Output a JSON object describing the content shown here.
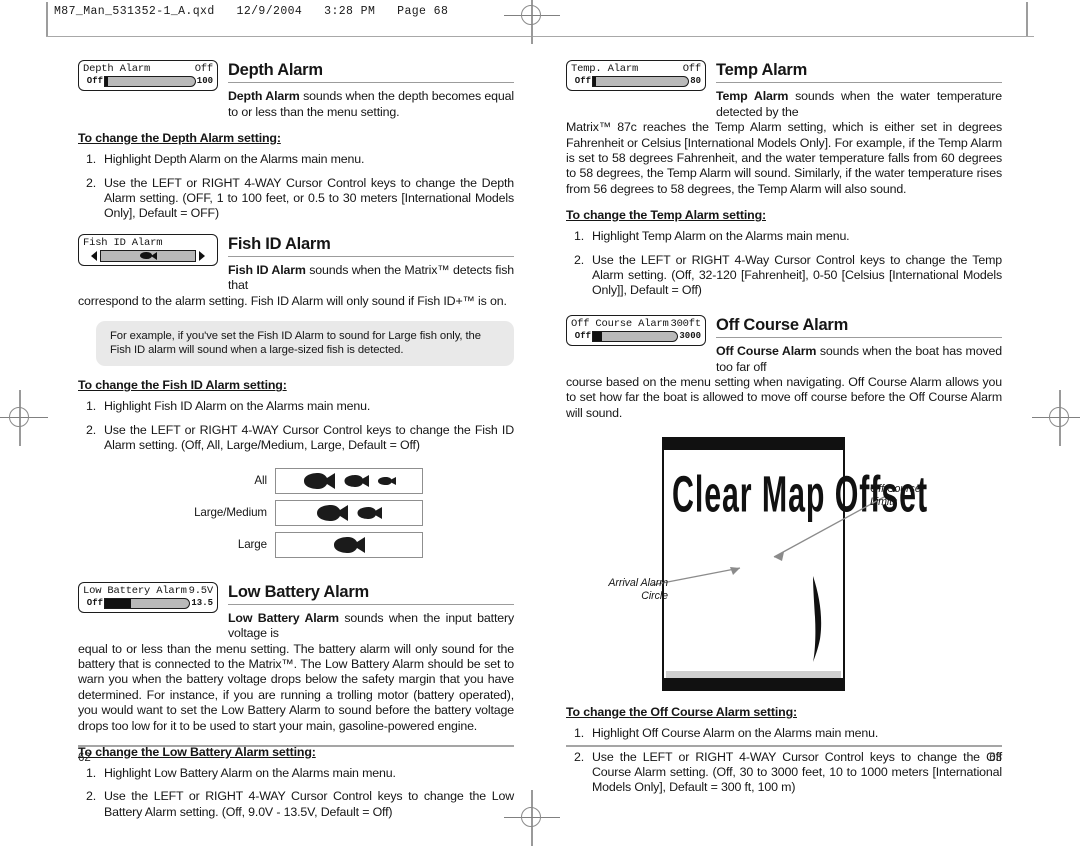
{
  "slug": "M87_Man_531352-1_A.qxd   12/9/2004   3:28 PM   Page 68",
  "left_page": {
    "number": "62",
    "sections": [
      {
        "id": "depth-alarm",
        "title": "Depth Alarm",
        "lcd": {
          "label": "Depth Alarm",
          "value": "Off",
          "min": "Off",
          "max": "100"
        },
        "lead_bold": "Depth Alarm",
        "lead_rest": " sounds when the depth becomes equal to or less than the menu setting.",
        "howto": "To change the Depth Alarm setting:",
        "steps": [
          "Highlight Depth Alarm on the Alarms main menu.",
          "Use the LEFT or RIGHT 4-WAY Cursor Control keys to change the Depth Alarm setting. (OFF, 1 to 100 feet, or 0.5 to 30 meters [International Models Only], Default = OFF)"
        ]
      },
      {
        "id": "fish-id-alarm",
        "title": "Fish ID Alarm",
        "lcd": {
          "label": "Fish ID Alarm",
          "value": "",
          "min": "",
          "max": ""
        },
        "lead_bold": "Fish ID Alarm",
        "lead_rest": " sounds when the Matrix™ detects fish that correspond to the alarm setting. Fish ID Alarm will only sound if Fish ID+™ is on.",
        "note": "For example, if you've set the Fish ID Alarm to sound for Large fish only, the Fish ID alarm will sound when a large-sized fish is detected.",
        "howto": "To change the Fish ID Alarm setting:",
        "steps": [
          "Highlight Fish ID Alarm on the Alarms main menu.",
          "Use the LEFT or RIGHT 4-WAY Cursor Control keys to change the Fish ID Alarm setting. (Off, All, Large/Medium, Large, Default = Off)"
        ],
        "fish_table": [
          {
            "label": "All",
            "sizes": [
              "large",
              "medium",
              "small"
            ]
          },
          {
            "label": "Large/Medium",
            "sizes": [
              "large",
              "medium"
            ]
          },
          {
            "label": "Large",
            "sizes": [
              "large"
            ]
          }
        ]
      },
      {
        "id": "low-battery-alarm",
        "title": "Low Battery Alarm",
        "lcd": {
          "label": "Low Battery Alarm",
          "value": "9.5V",
          "min": "Off",
          "max": "13.5"
        },
        "lead_bold": "Low Battery Alarm",
        "lead_rest": " sounds when the input battery voltage is equal to or less than the menu setting. The battery alarm will only sound for the battery that is connected to the Matrix™. The Low Battery Alarm should be set to warn you when the battery voltage drops below the safety margin that you have determined. For instance, if you are running a trolling motor (battery operated), you would want to set the Low Battery Alarm to sound before the battery voltage drops too low for it to be used to start your main, gasoline-powered engine.",
        "howto": "To change the Low Battery Alarm setting:",
        "steps": [
          "Highlight Low Battery Alarm on the Alarms main menu.",
          "Use the LEFT or RIGHT 4-WAY Cursor Control keys to change the Low Battery Alarm setting. (Off, 9.0V - 13.5V,  Default = Off)"
        ]
      }
    ]
  },
  "right_page": {
    "number": "63",
    "sections": [
      {
        "id": "temp-alarm",
        "title": "Temp Alarm",
        "lcd": {
          "label": "Temp. Alarm",
          "value": "Off",
          "min": "Off",
          "max": "80"
        },
        "lead_bold": "Temp Alarm",
        "lead_rest": " sounds when the water temperature detected by the Matrix™ 87c reaches the Temp Alarm setting, which is either set in degrees Fahrenheit or Celsius [International Models Only]. For example, if the Temp Alarm is set to 58 degrees Fahrenheit, and the water temperature falls from 60 degrees to 58 degrees, the Temp Alarm will sound. Similarly, if the water temperature rises from 56 degrees to 58 degrees, the Temp Alarm will also sound.",
        "howto": "To change the Temp Alarm setting:",
        "steps": [
          "Highlight Temp Alarm on the Alarms main menu.",
          "Use the LEFT or RIGHT 4-Way Cursor Control keys to change the Temp Alarm setting. (Off, 32-120 [Fahrenheit], 0-50 [Celsius [International Models Only]], Default = Off)"
        ]
      },
      {
        "id": "off-course-alarm",
        "title": "Off Course Alarm",
        "lcd": {
          "label": "Off Course Alarm",
          "value": "300ft",
          "min": "Off",
          "max": "3000"
        },
        "lead_bold": "Off Course Alarm",
        "lead_rest": " sounds when the boat has moved too far off course based on the menu setting when navigating. Off Course Alarm allows you to set how far the boat is allowed to move off course before the Off Course Alarm will sound.",
        "illustration": {
          "screen_text": "Clear Map Offset",
          "callout_right": "Off Course\nLimits",
          "callout_left": "Arrival Alarm\nCircle"
        },
        "howto": "To change the Off Course Alarm setting:",
        "steps": [
          "Highlight Off Course Alarm on the Alarms main  menu.",
          "Use the LEFT or RIGHT 4-WAY Cursor Control keys to change the Off Course Alarm setting. (Off, 30 to 3000 feet, 10 to 1000 meters [International Models Only], Default = 300 ft, 100 m)"
        ]
      }
    ]
  }
}
